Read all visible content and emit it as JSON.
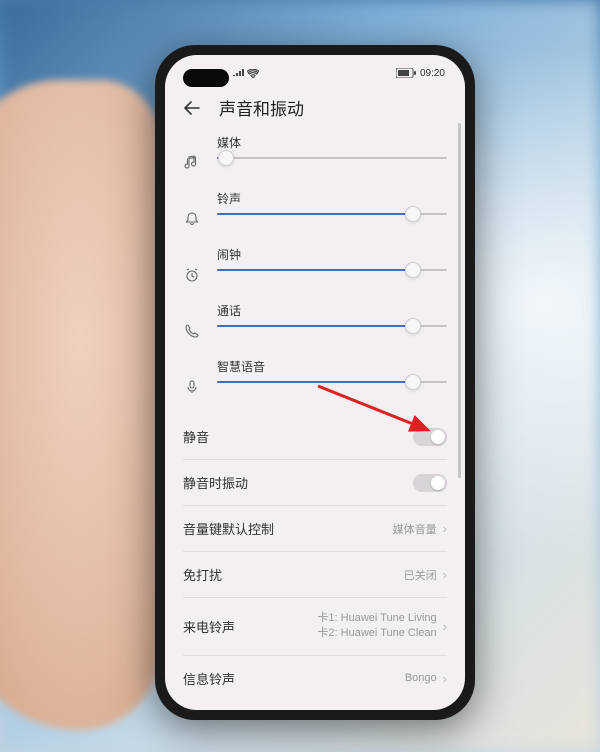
{
  "statusBar": {
    "time": "09:20",
    "battery": "78"
  },
  "header": {
    "title": "声音和振动"
  },
  "sliders": [
    {
      "label": "媒体",
      "value": 4
    },
    {
      "label": "铃声",
      "value": 85
    },
    {
      "label": "闹钟",
      "value": 85
    },
    {
      "label": "通话",
      "value": 85
    },
    {
      "label": "智慧语音",
      "value": 85
    }
  ],
  "toggles": [
    {
      "label": "静音",
      "on": false
    },
    {
      "label": "静音时振动",
      "on": false
    }
  ],
  "rows": [
    {
      "label": "音量键默认控制",
      "value": "媒体音量"
    },
    {
      "label": "免打扰",
      "value": "已关闭"
    },
    {
      "label": "来电铃声",
      "value": "卡1: Huawei Tune Living\n卡2: Huawei Tune Clean"
    },
    {
      "label": "信息铃声",
      "value": "Bongo"
    }
  ],
  "annotation": {
    "color": "#e02020"
  }
}
